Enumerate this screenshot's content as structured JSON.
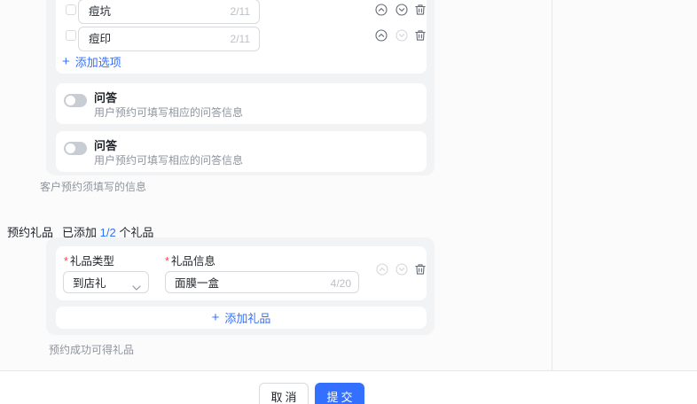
{
  "colors": {
    "primary": "#3370ff",
    "text": "#1f2329",
    "secondary_text": "#8f959e",
    "counter_text": "#bbc0c7",
    "container_bg": "#f2f3f5",
    "card_bg": "#ffffff",
    "border": "#d8dadd",
    "icon": "#646a73",
    "icon_disabled": "#d3d6da",
    "divider": "#e7e8ea",
    "danger": "#f54a45"
  },
  "option_list": {
    "items": [
      {
        "label": "痘坑",
        "counter": "2/11"
      },
      {
        "label": "痘印",
        "counter": "2/11"
      }
    ],
    "add_plus": "+",
    "add_label": "添加选项"
  },
  "qa_cards": [
    {
      "title": "问答",
      "subtitle": "用户预约可填写相应的问答信息",
      "toggle_state": "off"
    },
    {
      "title": "问答",
      "subtitle": "用户预约可填写相应的问答信息",
      "toggle_state": "off"
    }
  ],
  "hints": {
    "required_info": "客户预约须填写的信息",
    "gift_success": "预约成功可得礼品"
  },
  "gift_section": {
    "label": "预约礼品",
    "added_prefix": "已添加",
    "added_count": "1/2",
    "added_suffix": "个礼品",
    "required_mark": "*",
    "type_label": "礼品类型",
    "info_label": "礼品信息",
    "type_value": "到店礼",
    "info_value": "面膜一盒",
    "info_counter": "4/20",
    "add_plus": "+",
    "add_label": "添加礼品"
  },
  "footer": {
    "cancel": "取消",
    "submit": "提交"
  }
}
